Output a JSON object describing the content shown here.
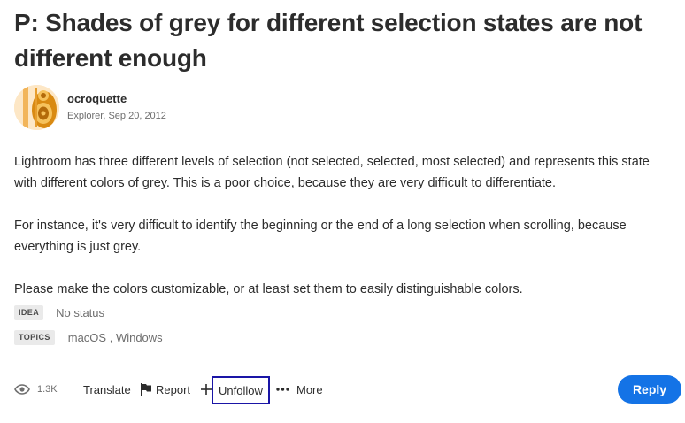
{
  "post": {
    "title": "P: Shades of grey for different selection states are not different enough",
    "author": {
      "name": "ocroquette",
      "role_date": "Explorer, Sep 20, 2012",
      "avatar_icon": "speaker-avatar"
    },
    "paragraphs": [
      "Lightroom has three different levels of selection (not selected, selected, most selected) and represents this state with different colors of grey. This is a poor choice, because they are very difficult to differentiate.",
      "For instance, it's very difficult to identify the beginning or the end of a long selection when scrolling, because everything is just grey.",
      "Please make the colors customizable, or at least set them to easily distinguishable colors."
    ],
    "idea": {
      "label": "IDEA",
      "value": "No status"
    },
    "topics": {
      "label": "TOPICS",
      "items": [
        "macOS",
        "Windows"
      ],
      "separator": " , "
    }
  },
  "actions": {
    "views": "1.3K",
    "translate": "Translate",
    "report": "Report",
    "unfollow": "Unfollow",
    "more": "More",
    "reply": "Reply"
  },
  "colors": {
    "reply_bg": "#1473e6",
    "focus_outline": "#1a15a6",
    "tag_bg": "#eaeaea"
  }
}
